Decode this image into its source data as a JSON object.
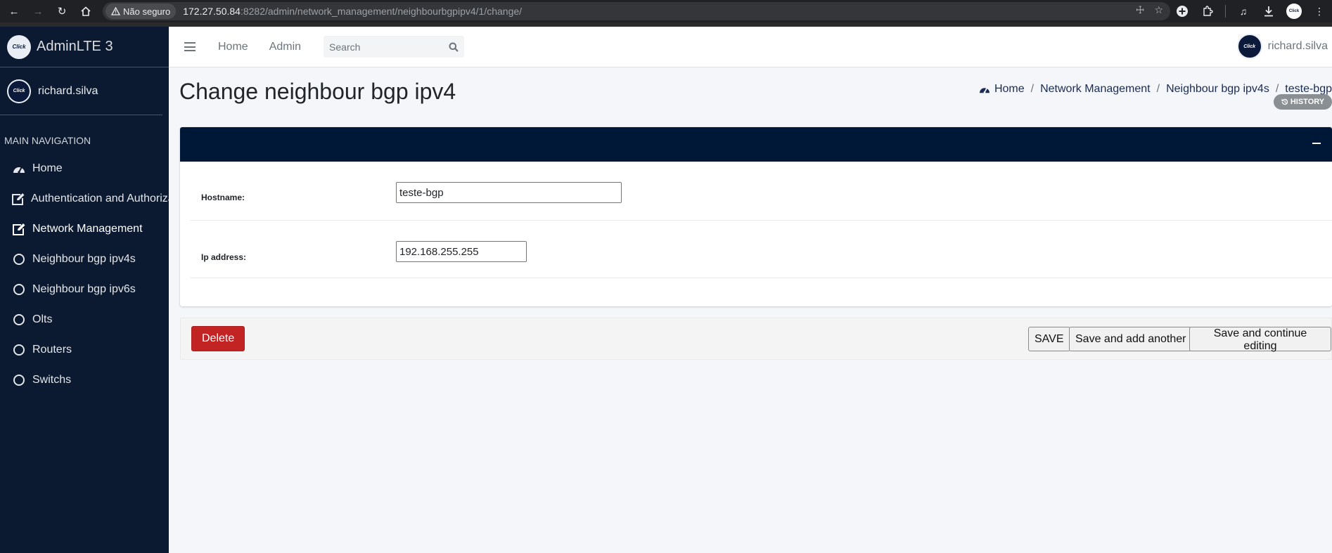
{
  "browser": {
    "security_label": "Não seguro",
    "url_host": "172.27.50.84",
    "url_rest": ":8282/admin/network_management/neighbourbgpipv4/1/change/"
  },
  "sidebar": {
    "brand": "AdminLTE 3",
    "logo_text": "Click",
    "user": "richard.silva",
    "nav_header": "MAIN NAVIGATION",
    "items": [
      {
        "label": "Home",
        "icon": "dashboard-gauge-icon"
      },
      {
        "label": "Authentication and Authorization",
        "icon": "edit-icon"
      },
      {
        "label": "Network Management",
        "icon": "edit-icon"
      },
      {
        "label": "Neighbour bgp ipv4s",
        "icon": "circle-icon"
      },
      {
        "label": "Neighbour bgp ipv6s",
        "icon": "circle-icon"
      },
      {
        "label": "Olts",
        "icon": "circle-icon"
      },
      {
        "label": "Routers",
        "icon": "circle-icon"
      },
      {
        "label": "Switchs",
        "icon": "circle-icon"
      }
    ]
  },
  "topnav": {
    "home": "Home",
    "admin": "Admin",
    "search_placeholder": "Search",
    "user": "richard.silva"
  },
  "page": {
    "title": "Change neighbour bgp ipv4",
    "breadcrumb": [
      "Home",
      "Network Management",
      "Neighbour bgp ipv4s",
      "teste-bgp"
    ],
    "history": "HISTORY"
  },
  "form": {
    "hostname_label": "Hostname:",
    "hostname_value": "teste-bgp",
    "ip_label": "Ip address:",
    "ip_value": "192.168.255.255"
  },
  "actions": {
    "delete": "Delete",
    "save": "SAVE",
    "save_add_another": "Save and add another",
    "save_continue": "Save and continue editing"
  },
  "colors": {
    "sidebar_bg": "#0b1a30",
    "card_header_bg": "#001837",
    "delete_bg": "#c22323"
  }
}
